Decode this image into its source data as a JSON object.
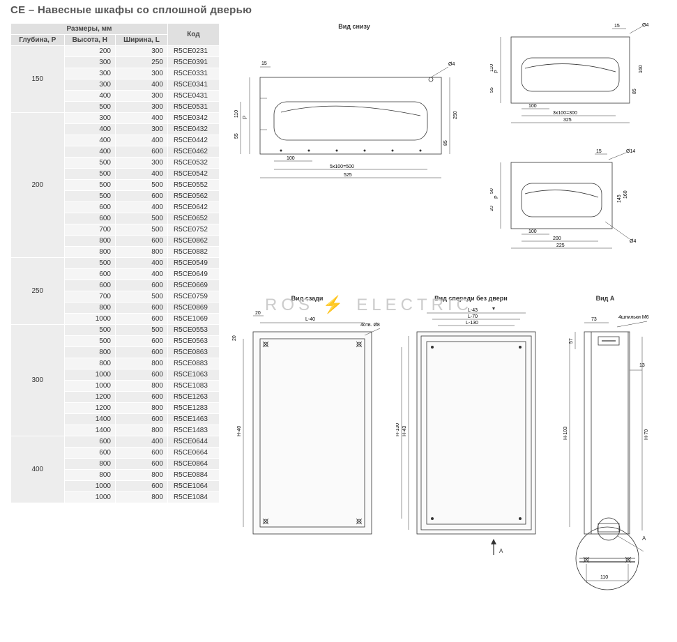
{
  "title": "CE – Навесные шкафы со сплошной дверью",
  "table": {
    "header_group": "Размеры, мм",
    "hdr_depth": "Глубина, P",
    "hdr_height": "Высота, H",
    "hdr_width": "Ширина, L",
    "hdr_code": "Код",
    "groups": [
      {
        "depth": "150",
        "rows": [
          {
            "h": "200",
            "l": "300",
            "code": "R5CE0231"
          },
          {
            "h": "300",
            "l": "250",
            "code": "R5CE0391"
          },
          {
            "h": "300",
            "l": "300",
            "code": "R5CE0331"
          },
          {
            "h": "300",
            "l": "400",
            "code": "R5CE0341"
          },
          {
            "h": "400",
            "l": "300",
            "code": "R5CE0431"
          },
          {
            "h": "500",
            "l": "300",
            "code": "R5CE0531"
          }
        ]
      },
      {
        "depth": "200",
        "rows": [
          {
            "h": "300",
            "l": "400",
            "code": "R5CE0342"
          },
          {
            "h": "400",
            "l": "300",
            "code": "R5CE0432"
          },
          {
            "h": "400",
            "l": "400",
            "code": "R5CE0442"
          },
          {
            "h": "400",
            "l": "600",
            "code": "R5CE0462"
          },
          {
            "h": "500",
            "l": "300",
            "code": "R5CE0532"
          },
          {
            "h": "500",
            "l": "400",
            "code": "R5CE0542"
          },
          {
            "h": "500",
            "l": "500",
            "code": "R5CE0552"
          },
          {
            "h": "500",
            "l": "600",
            "code": "R5CE0562"
          },
          {
            "h": "600",
            "l": "400",
            "code": "R5CE0642"
          },
          {
            "h": "600",
            "l": "500",
            "code": "R5CE0652"
          },
          {
            "h": "700",
            "l": "500",
            "code": "R5CE0752"
          },
          {
            "h": "800",
            "l": "600",
            "code": "R5CE0862"
          },
          {
            "h": "800",
            "l": "800",
            "code": "R5CE0882"
          }
        ]
      },
      {
        "depth": "250",
        "rows": [
          {
            "h": "500",
            "l": "400",
            "code": "R5CE0549"
          },
          {
            "h": "600",
            "l": "400",
            "code": "R5CE0649"
          },
          {
            "h": "600",
            "l": "600",
            "code": "R5CE0669"
          },
          {
            "h": "700",
            "l": "500",
            "code": "R5CE0759"
          },
          {
            "h": "800",
            "l": "600",
            "code": "R5CE0869"
          },
          {
            "h": "1000",
            "l": "600",
            "code": "R5CE1069"
          }
        ]
      },
      {
        "depth": "300",
        "rows": [
          {
            "h": "500",
            "l": "500",
            "code": "R5CE0553"
          },
          {
            "h": "500",
            "l": "600",
            "code": "R5CE0563"
          },
          {
            "h": "800",
            "l": "600",
            "code": "R5CE0863"
          },
          {
            "h": "800",
            "l": "800",
            "code": "R5CE0883"
          },
          {
            "h": "1000",
            "l": "600",
            "code": "R5CE1063"
          },
          {
            "h": "1000",
            "l": "800",
            "code": "R5CE1083"
          },
          {
            "h": "1200",
            "l": "600",
            "code": "R5CE1263"
          },
          {
            "h": "1200",
            "l": "800",
            "code": "R5CE1283"
          },
          {
            "h": "1400",
            "l": "600",
            "code": "R5CE1463"
          },
          {
            "h": "1400",
            "l": "800",
            "code": "R5CE1483"
          }
        ]
      },
      {
        "depth": "400",
        "rows": [
          {
            "h": "600",
            "l": "400",
            "code": "R5CE0644"
          },
          {
            "h": "600",
            "l": "600",
            "code": "R5CE0664"
          },
          {
            "h": "800",
            "l": "600",
            "code": "R5CE0864"
          },
          {
            "h": "800",
            "l": "800",
            "code": "R5CE0884"
          },
          {
            "h": "1000",
            "l": "600",
            "code": "R5CE1064"
          },
          {
            "h": "1000",
            "l": "800",
            "code": "R5CE1084"
          }
        ]
      }
    ]
  },
  "diagrams": {
    "bottom_view_title": "Вид снизу",
    "rear_view_title": "Вид сзади",
    "front_view_title": "Вид спереди без двери",
    "view_a_title": "Вид A",
    "labels": {
      "d_15": "15",
      "d_55": "55",
      "d_110": "110",
      "d_100": "100",
      "d_5x100": "5x100=500",
      "d_525": "525",
      "d_250": "250",
      "d_85": "85",
      "d_P": "P",
      "d_4": "Ø4",
      "d_3x100": "3x100=300",
      "d_325": "325",
      "d_160": "160",
      "d_145": "145",
      "d_200": "200",
      "d_225": "225",
      "d_14": "Ø14",
      "d_50": "50",
      "d_20": "20",
      "d_L40": "L-40",
      "d_4holes": "4отв. Ø8",
      "d_H40": "H-40",
      "d_A": "A",
      "d_L43": "L-43",
      "d_L70": "L-70",
      "d_L130": "L-130",
      "d_H43": "H-43",
      "d_H130": "H-130",
      "d_73": "73",
      "d_4pins": "4шпильки M6",
      "d_57": "57",
      "d_13": "13",
      "d_H103": "H-103",
      "d_H70": "H-70"
    }
  },
  "watermark_a": "ROS",
  "watermark_b": "ELECTRIC"
}
